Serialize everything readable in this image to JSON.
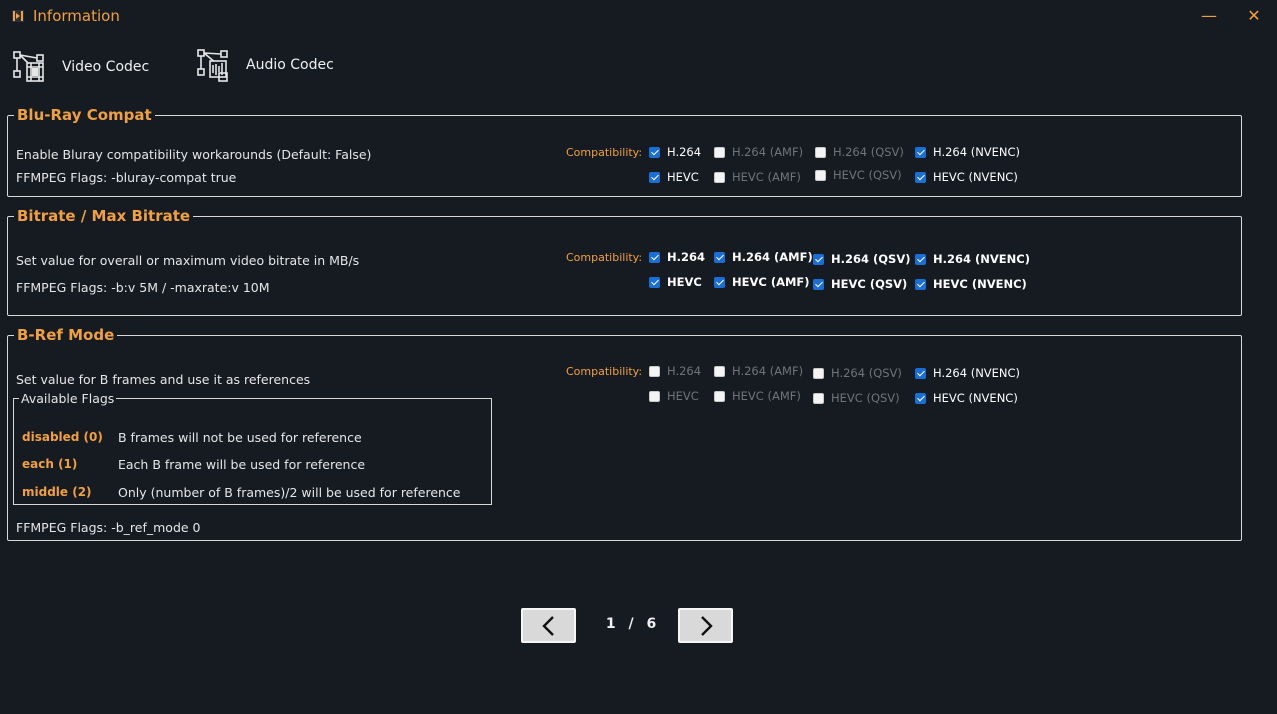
{
  "window": {
    "title": "Information",
    "minimize": "—",
    "close": "✕"
  },
  "tabs": [
    {
      "label": "Video Codec",
      "icon": "video-codec-icon"
    },
    {
      "label": "Audio Codec",
      "icon": "audio-codec-icon"
    }
  ],
  "compat_label": "Compatibility:",
  "sections": [
    {
      "title": "Blu-Ray Compat",
      "desc": "Enable Bluray compatibility workarounds  (Default: False)",
      "flags": "FFMPEG Flags: -bluray-compat true",
      "compat": [
        [
          {
            "label": "H.264",
            "checked": true
          },
          {
            "label": "H.264 (AMF)",
            "checked": false
          },
          {
            "label": "H.264 (QSV)",
            "checked": false
          },
          {
            "label": "H.264 (NVENC)",
            "checked": true
          }
        ],
        [
          {
            "label": "HEVC",
            "checked": true
          },
          {
            "label": "HEVC (AMF)",
            "checked": false
          },
          {
            "label": "HEVC (QSV)",
            "checked": false
          },
          {
            "label": "HEVC (NVENC)",
            "checked": true
          }
        ]
      ]
    },
    {
      "title": "Bitrate / Max Bitrate",
      "desc": "Set value for overall or maximum video bitrate in MB/s",
      "flags": "FFMPEG Flags: -b:v 5M / -maxrate:v 10M",
      "compat": [
        [
          {
            "label": "H.264",
            "checked": true
          },
          {
            "label": "H.264 (AMF)",
            "checked": true
          },
          {
            "label": "H.264 (QSV)",
            "checked": true
          },
          {
            "label": "H.264 (NVENC)",
            "checked": true
          }
        ],
        [
          {
            "label": "HEVC",
            "checked": true
          },
          {
            "label": "HEVC (AMF)",
            "checked": true
          },
          {
            "label": "HEVC (QSV)",
            "checked": true
          },
          {
            "label": "HEVC (NVENC)",
            "checked": true
          }
        ]
      ]
    },
    {
      "title": "B-Ref Mode",
      "desc": "Set value for B frames and use it as references",
      "flags": "FFMPEG Flags: -b_ref_mode 0",
      "available_flags_title": "Available Flags",
      "available_flags": [
        {
          "key": "disabled (0)",
          "value": "B frames will not be used for reference"
        },
        {
          "key": "each (1)",
          "value": "Each B frame will be used for reference"
        },
        {
          "key": "middle (2)",
          "value": "Only (number of B frames)/2 will be used for reference"
        }
      ],
      "compat": [
        [
          {
            "label": "H.264",
            "checked": false
          },
          {
            "label": "H.264 (AMF)",
            "checked": false
          },
          {
            "label": "H.264 (QSV)",
            "checked": false
          },
          {
            "label": "H.264 (NVENC)",
            "checked": true
          }
        ],
        [
          {
            "label": "HEVC",
            "checked": false
          },
          {
            "label": "HEVC (AMF)",
            "checked": false
          },
          {
            "label": "HEVC (QSV)",
            "checked": false
          },
          {
            "label": "HEVC (NVENC)",
            "checked": true
          }
        ]
      ]
    }
  ],
  "pagination": {
    "current": "1",
    "separator": "/",
    "total": "6"
  },
  "colors": {
    "accent": "#f0a040",
    "background": "#161b22",
    "checkbox": "#1a6fd6"
  }
}
